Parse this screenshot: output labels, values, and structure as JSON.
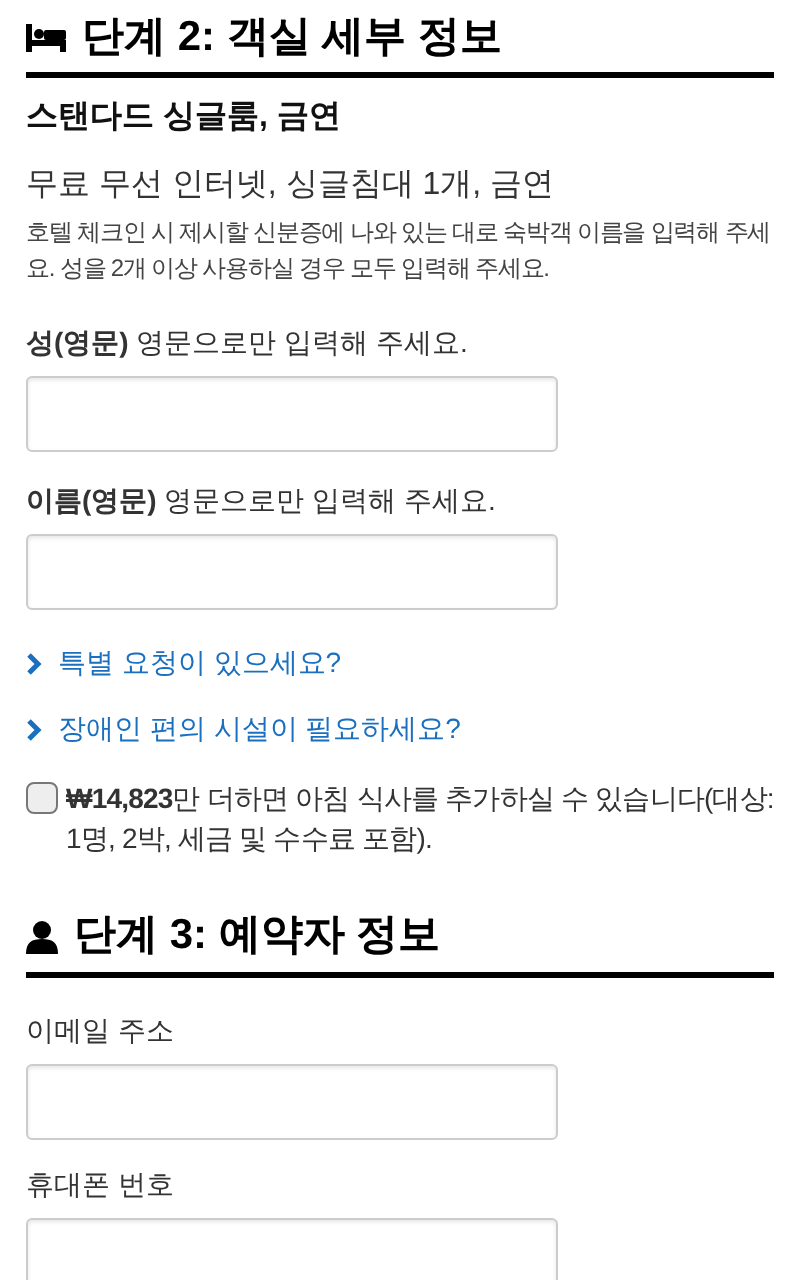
{
  "step2": {
    "kind": "room",
    "title": "단계 2: 객실 세부 정보",
    "room_name": "스탠다드 싱글룸, 금연",
    "amenities": "무료 무선 인터넷, 싱글침대 1개, 금연",
    "note": "호텔 체크인 시 제시할 신분증에 나와 있는 대로 숙박객 이름을 입력해 주세요. 성을 2개 이상 사용하실 경우 모두 입력해 주세요.",
    "fields": [
      {
        "label": "**성(영문)** 영문으로만 입력해 주세요."
      },
      {
        "label": "**이름(영문)** 영문으로만 입력해 주세요."
      }
    ],
    "links": [
      "특별 요청이 있으세요?",
      "장애인 편의 시설이 필요하세요?"
    ],
    "breakfast": {
      "checked": false,
      "text": "**₩14,823**만 더하면 아침 식사를 추가하실 수 있습니다(대상: 1명, 2박, 세금 및 수수료 포함)."
    }
  },
  "step3": {
    "kind": "person",
    "title": "단계 3: 예약자 정보",
    "fields": [
      {
        "label": "이메일 주소"
      },
      {
        "label": "휴대폰 번호"
      }
    ]
  }
}
